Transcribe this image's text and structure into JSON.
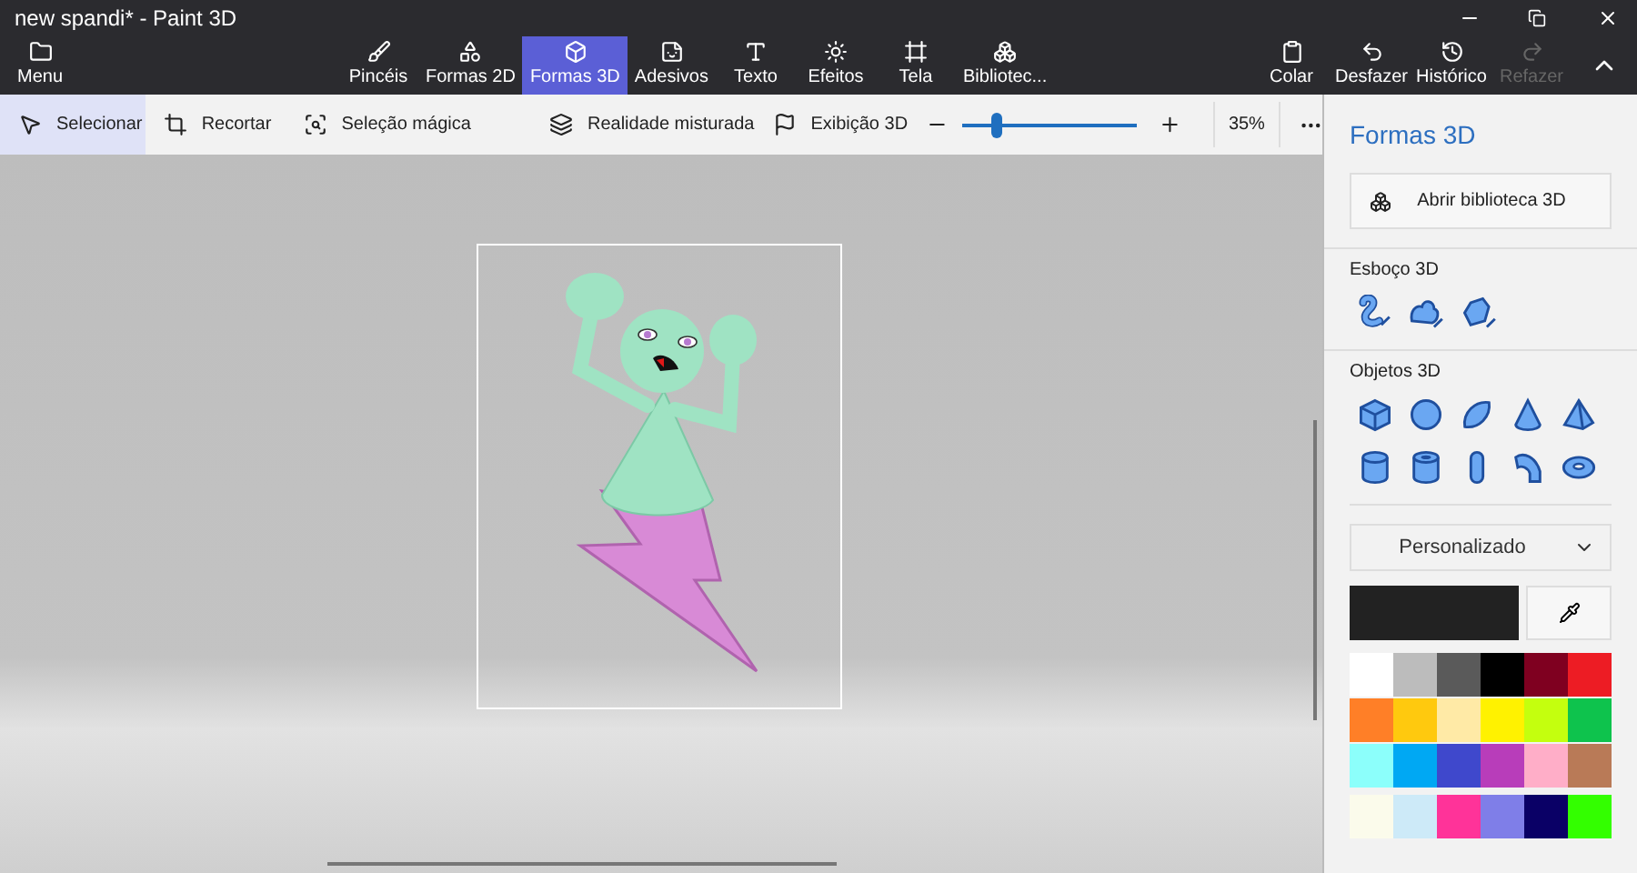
{
  "window": {
    "title": "new spandi* - Paint 3D"
  },
  "menu": {
    "label": "Menu"
  },
  "tools": [
    {
      "label": "Pincéis",
      "selected": false
    },
    {
      "label": "Formas 2D",
      "selected": false
    },
    {
      "label": "Formas 3D",
      "selected": true
    },
    {
      "label": "Adesivos",
      "selected": false
    },
    {
      "label": "Texto",
      "selected": false
    },
    {
      "label": "Efeitos",
      "selected": false
    },
    {
      "label": "Tela",
      "selected": false
    },
    {
      "label": "Bibliotec...",
      "selected": false
    }
  ],
  "actions": [
    {
      "label": "Colar",
      "disabled": false
    },
    {
      "label": "Desfazer",
      "disabled": false
    },
    {
      "label": "Histórico",
      "disabled": false
    },
    {
      "label": "Refazer",
      "disabled": true
    }
  ],
  "toolbar": {
    "items": [
      {
        "label": "Selecionar",
        "selected": true
      },
      {
        "label": "Recortar",
        "selected": false
      },
      {
        "label": "Seleção mágica",
        "selected": false
      },
      {
        "label": "Realidade misturada",
        "selected": false
      },
      {
        "label": "Exibição 3D",
        "selected": false
      }
    ],
    "zoom": {
      "level": 0.2,
      "reading": "35%"
    }
  },
  "panel": {
    "title": "Formas 3D",
    "library_button": "Abrir biblioteca 3D",
    "sketch_title": "Esboço 3D",
    "objects_title": "Objetos 3D",
    "dropdown": {
      "value": "Personalizado"
    },
    "current_color": {
      "color": "#222222"
    },
    "palette": [
      {
        "color": "#ffffff"
      },
      {
        "color": "#bcbcbc"
      },
      {
        "color": "#5a5a5a"
      },
      {
        "color": "#000000"
      },
      {
        "color": "#7f0020"
      },
      {
        "color": "#ed1c24"
      },
      {
        "color": "#ff7f27"
      },
      {
        "color": "#ffc90e"
      },
      {
        "color": "#ffeaa6"
      },
      {
        "color": "#fff200"
      },
      {
        "color": "#c4ff0e"
      },
      {
        "color": "#0ec34d"
      },
      {
        "color": "#8cfffb"
      },
      {
        "color": "#00a8f3"
      },
      {
        "color": "#3f48cc"
      },
      {
        "color": "#b83dba"
      },
      {
        "color": "#ffaec8"
      },
      {
        "color": "#b97a57"
      }
    ],
    "recent_colors": [
      {
        "color": "#fbfbeb"
      },
      {
        "color": "#cdeaf8"
      },
      {
        "color": "#ff3399"
      },
      {
        "color": "#7f7ee8"
      },
      {
        "color": "#0a0066"
      },
      {
        "color": "#33ff00"
      }
    ]
  }
}
